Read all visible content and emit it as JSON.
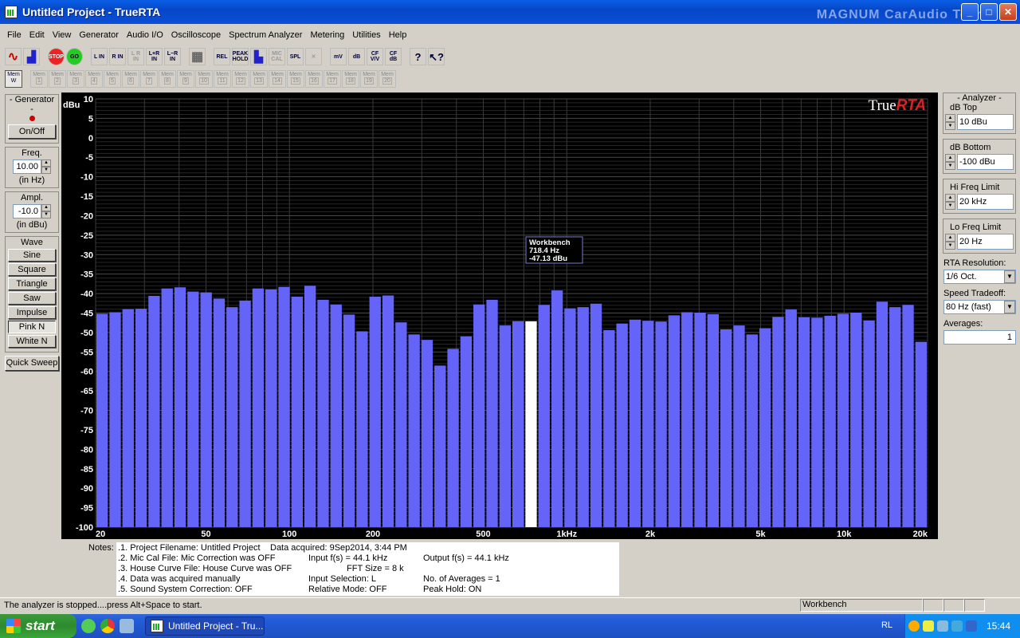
{
  "window": {
    "title": "Untitled Project - TrueRTA",
    "watermark": "MAGNUM CarAudio Team"
  },
  "menu": [
    "File",
    "Edit",
    "View",
    "Generator",
    "Audio I/O",
    "Oscilloscope",
    "Spectrum Analyzer",
    "Metering",
    "Utilities",
    "Help"
  ],
  "toolbar": {
    "buttons": [
      {
        "name": "sine-wave-icon",
        "label": "∿"
      },
      {
        "name": "spectrum-icon",
        "label": "▟"
      },
      {
        "name": "stop-button",
        "label": "STOP"
      },
      {
        "name": "go-button",
        "label": "GO"
      },
      {
        "name": "l-in-button",
        "label": "L IN"
      },
      {
        "name": "r-in-button",
        "label": "R IN"
      },
      {
        "name": "lr-in-button",
        "label": "L R IN"
      },
      {
        "name": "l-plus-r-in-button",
        "label": "L+R IN"
      },
      {
        "name": "l-minus-r-in-button",
        "label": "L−R IN"
      },
      {
        "name": "grid-button",
        "label": "▦"
      },
      {
        "name": "rel-button",
        "label": "REL"
      },
      {
        "name": "peak-hold-button",
        "label": "PEAK HOLD"
      },
      {
        "name": "bars-button",
        "label": "▙"
      },
      {
        "name": "mic-cal-button",
        "label": "MIC CAL"
      },
      {
        "name": "spl-button",
        "label": "SPL"
      },
      {
        "name": "cancel-button",
        "label": "✕"
      },
      {
        "name": "mv-button",
        "label": "mV"
      },
      {
        "name": "db-button",
        "label": "dB"
      },
      {
        "name": "cf-vv-button",
        "label": "CF V/V"
      },
      {
        "name": "cf-db-button",
        "label": "CF dB"
      },
      {
        "name": "help-button",
        "label": "?"
      },
      {
        "name": "context-help-button",
        "label": "↖?"
      }
    ]
  },
  "memories": {
    "active_label": "Mem W",
    "slots": [
      "1",
      "2",
      "3",
      "4",
      "5",
      "6",
      "7",
      "8",
      "9",
      "10",
      "11",
      "12",
      "13",
      "14",
      "15",
      "16",
      "17",
      "18",
      "19",
      "20"
    ],
    "slot_prefix": "Mem"
  },
  "generator": {
    "title": "- Generator -",
    "on_off": "On/Off",
    "freq_label": "Freq.",
    "freq_value": "10.00",
    "freq_unit": "(in Hz)",
    "ampl_label": "Ampl.",
    "ampl_value": "-10.0",
    "ampl_unit": "(in dBu)",
    "wave_label": "Wave",
    "waves": [
      "Sine",
      "Square",
      "Triangle",
      "Saw",
      "Impulse",
      "Pink N",
      "White N"
    ],
    "active_wave": "Pink N",
    "quick_sweep": "Quick Sweep"
  },
  "analyzer": {
    "title": "- Analyzer -",
    "db_top_label": "dB Top",
    "db_top_value": "10 dBu",
    "db_bottom_label": "dB Bottom",
    "db_bottom_value": "-100 dBu",
    "hi_freq_label": "Hi Freq Limit",
    "hi_freq_value": "20 kHz",
    "lo_freq_label": "Lo Freq Limit",
    "lo_freq_value": "20 Hz",
    "rta_res_label": "RTA Resolution:",
    "rta_res_value": "1/6 Oct.",
    "speed_label": "Speed Tradeoff:",
    "speed_value": "80 Hz (fast)",
    "averages_label": "Averages:",
    "averages_value": "1"
  },
  "chart_data": {
    "type": "bar",
    "brand": "TrueRTA",
    "ylabel": "dBu",
    "ylim": [
      -100,
      10
    ],
    "yticks": [
      10,
      5,
      0,
      -5,
      -10,
      -15,
      -20,
      -25,
      -30,
      -35,
      -40,
      -45,
      -50,
      -55,
      -60,
      -65,
      -70,
      -75,
      -80,
      -85,
      -90,
      -95,
      -100
    ],
    "xlim_hz": [
      20,
      20000
    ],
    "xscale": "log",
    "xticks": [
      {
        "hz": 20,
        "label": "20"
      },
      {
        "hz": 50,
        "label": "50"
      },
      {
        "hz": 100,
        "label": "100"
      },
      {
        "hz": 200,
        "label": "200"
      },
      {
        "hz": 500,
        "label": "500"
      },
      {
        "hz": 1000,
        "label": "1kHz"
      },
      {
        "hz": 2000,
        "label": "2k"
      },
      {
        "hz": 5000,
        "label": "5k"
      },
      {
        "hz": 10000,
        "label": "10k"
      },
      {
        "hz": 20000,
        "label": "20k"
      }
    ],
    "resolution": "1/6 Oct.",
    "bar_color": "#6464f8",
    "highlight_color": "#ffffff",
    "highlight_index": 33,
    "series": [
      {
        "values": [
          -45.2,
          -44.8,
          -44.0,
          -43.9,
          -40.6,
          -38.7,
          -38.4,
          -39.5,
          -39.7,
          -41.3,
          -43.5,
          -41.8,
          -38.7,
          -38.9,
          -38.3,
          -40.8,
          -38.0,
          -41.6,
          -42.8,
          -45.4,
          -49.7,
          -40.8,
          -40.5,
          -47.4,
          -50.5,
          -51.9,
          -58.5,
          -54.2,
          -51.0,
          -42.8,
          -41.6,
          -48.2,
          -47.1,
          -47.13,
          -42.9,
          -39.2,
          -43.8,
          -43.5,
          -42.6,
          -49.4,
          -47.7,
          -46.7,
          -47.0,
          -47.2,
          -45.6,
          -44.8,
          -44.9,
          -45.3,
          -49.2,
          -48.2,
          -50.5,
          -48.9,
          -46.0,
          -44.1,
          -46.1,
          -46.2,
          -45.7,
          -45.2,
          -44.9,
          -46.9,
          -42.1,
          -43.5,
          -42.9,
          -52.4
        ]
      }
    ],
    "tooltip": {
      "title": "Workbench",
      "freq": "718.4 Hz",
      "level": "-47.13 dBu"
    }
  },
  "notes": {
    "label": "Notes:",
    "lines": [
      ".1. Project Filename: Untitled Project",
      ".2. Mic Cal File: Mic Correction was OFF",
      ".3. House Curve File: House Curve was OFF",
      ".4. Data was acquired manually",
      ".5. Sound System Correction: OFF"
    ],
    "data_acquired": "Data acquired: 9Sep2014, 3:44 PM",
    "input_fs": "Input f(s) = 44.1 kHz",
    "fft_size": "FFT Size = 8 k",
    "input_selection": "Input Selection: L",
    "relative_mode": "Relative Mode:  OFF",
    "output_fs": "Output f(s) = 44.1 kHz",
    "num_averages": "No. of Averages = 1",
    "peak_hold": "Peak Hold: ON"
  },
  "status": {
    "message": "The analyzer is stopped....press Alt+Space to start.",
    "workbench": "Workbench"
  },
  "taskbar": {
    "start": "start",
    "task": "Untitled Project - Tru...",
    "lang": "RL",
    "clock": "15:44"
  }
}
